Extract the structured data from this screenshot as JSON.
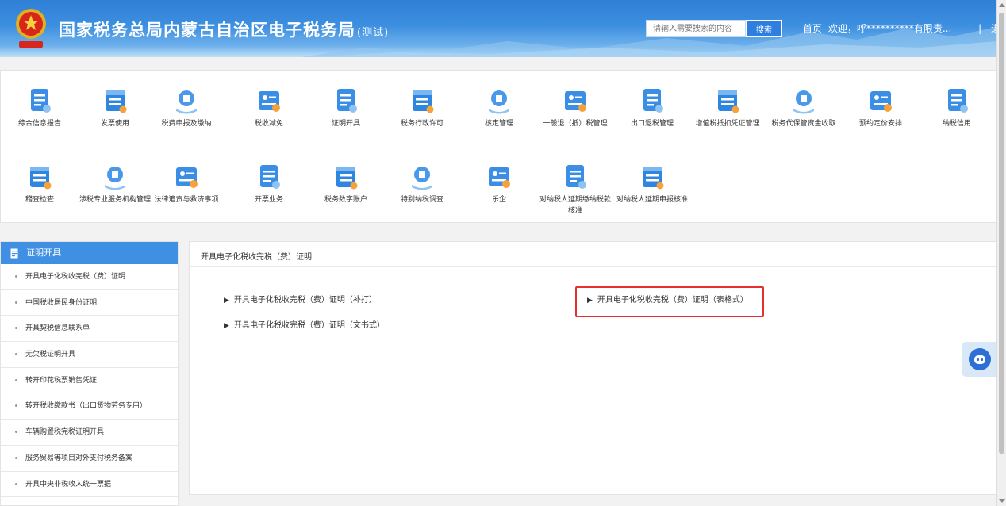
{
  "header": {
    "title": "国家税务总局内蒙古自治区电子税务局",
    "title_suffix": "(测试)",
    "search_placeholder": "请输入需要搜索的内容",
    "search_button": "搜索",
    "nav_home": "首页",
    "nav_welcome": "欢迎，呼**********有限责...",
    "nav_sep": "|",
    "nav_logout": "退出"
  },
  "icons": [
    {
      "label": "综合信息报告",
      "icon": "report-icon"
    },
    {
      "label": "发票使用",
      "icon": "invoice-icon"
    },
    {
      "label": "税费申报及缴纳",
      "icon": "tax-payment-icon"
    },
    {
      "label": "税收减免",
      "icon": "tax-relief-icon"
    },
    {
      "label": "证明开具",
      "icon": "certificate-icon"
    },
    {
      "label": "税务行政许可",
      "icon": "license-icon"
    },
    {
      "label": "核定管理",
      "icon": "verify-icon"
    },
    {
      "label": "一般退（抵）税管理",
      "icon": "refund-icon"
    },
    {
      "label": "出口退税管理",
      "icon": "export-refund-icon"
    },
    {
      "label": "增值税抵扣凭证管理",
      "icon": "vat-voucher-icon"
    },
    {
      "label": "税务代保管资金收取",
      "icon": "custody-fund-icon"
    },
    {
      "label": "预约定价安排",
      "icon": "pricing-icon"
    },
    {
      "label": "纳税信用",
      "icon": "credit-icon"
    },
    {
      "label": "稽查检查",
      "icon": "inspection-icon"
    },
    {
      "label": "涉税专业服务机构管理",
      "icon": "agency-icon"
    },
    {
      "label": "法律追责与救济事项",
      "icon": "law-icon"
    },
    {
      "label": "开票业务",
      "icon": "billing-icon"
    },
    {
      "label": "税务数字账户",
      "icon": "digital-account-icon"
    },
    {
      "label": "特别纳税调查",
      "icon": "investigation-icon"
    },
    {
      "label": "乐企",
      "icon": "leqi-icon"
    },
    {
      "label": "对纳税人延期缴纳税款核准",
      "icon": "deferral-payment-icon"
    },
    {
      "label": "对纳税人延期申报核准",
      "icon": "deferral-filing-icon"
    }
  ],
  "sidebar": {
    "title": "证明开具",
    "items": [
      "开具电子化税收完税（费）证明",
      "中国税收居民身份证明",
      "开具契税信息联系单",
      "无欠税证明开具",
      "转开印花税票销售凭证",
      "转开税收缴款书（出口货物劳务专用）",
      "车辆购置税完税证明开具",
      "服务贸易等项目对外支付税务备案",
      "开具中央非税收入统一票据"
    ]
  },
  "content": {
    "title": "开具电子化税收完税（费）证明",
    "links": [
      "开具电子化税收完税（费）证明（补打）",
      "开具电子化税收完税（费）证明（文书式）",
      "开具电子化税收完税（费）证明（表格式）"
    ]
  },
  "colors": {
    "brand_blue": "#3f8fe3",
    "highlight_red": "#e53030"
  }
}
